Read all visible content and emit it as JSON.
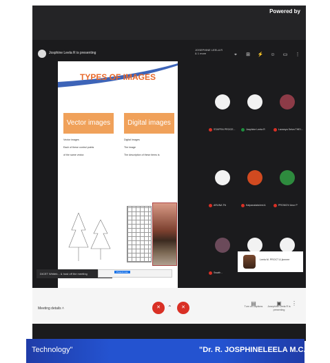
{
  "branding": {
    "powered_by": "Powered by"
  },
  "presenter_bar": {
    "presenter_label": "Josphine Leela R is presenting",
    "more_text": "JOSEPHINE LEELA R & 1 more"
  },
  "slide": {
    "title": "TYPES OF IMAGES",
    "left_heading": "Vector images",
    "right_heading": "Digital images",
    "left_points": [
      "Vector images",
      "Each of these control points",
      "of the same vector."
    ],
    "right_points": [
      "Digital Images",
      "The image",
      "The description of these items is"
    ],
    "toolbar_button": "Present now"
  },
  "caption_left": "DICET Whiteb... & host off the meeting",
  "participants": [
    {
      "name": "STAFFIN PROCE...",
      "avatar_color": "#f2f2f2"
    },
    {
      "name": "Josphine Leela R",
      "avatar_color": "#f2f2f2"
    },
    {
      "name": "Lavanya Selva THEI...",
      "avatar_color": "#8d3b47"
    },
    {
      "name": "ARUNA TN",
      "avatar_color": "#f2f2f2"
    },
    {
      "name": "Kalpanalakshmi A",
      "avatar_color": "#d14a20"
    },
    {
      "name": "PROMOV Anur P",
      "avatar_color": "#2e8b3e"
    },
    {
      "name": "Swath .. ",
      "avatar_color": "#6b4a5a"
    },
    {
      "name": "",
      "avatar_color": "#f2f2f2"
    },
    {
      "name": "",
      "avatar_color": "#f2f2f2"
    }
  ],
  "self_view": {
    "label": "Leela M. PROCT & jionnee"
  },
  "controls": {
    "meeting_details": "Meeting details",
    "leave_label": "",
    "captions_label": "Turn on captions",
    "present_label": "Josephine Leela R is presenting"
  },
  "banner": {
    "left": "Technology\"",
    "right": "\"Dr. R. JOSPHINELEELA M.C.A, M.E, Ph"
  }
}
